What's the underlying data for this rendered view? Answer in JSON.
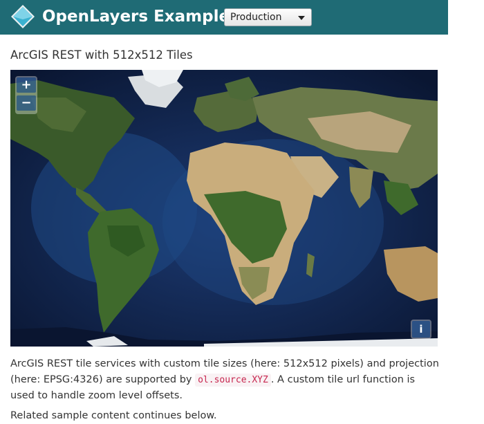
{
  "header": {
    "brand": "OpenLayers Examples",
    "mode_select": {
      "value": "Production"
    },
    "background_color": "#1f6b75"
  },
  "example": {
    "title": "ArcGIS REST with 512x512 Tiles"
  },
  "map": {
    "zoom_in_label": "+",
    "zoom_out_label": "−",
    "attribution_label": "i",
    "ocean_color": "#0b1a38"
  },
  "description": {
    "part1": "ArcGIS REST tile services with custom tile sizes (here: 512x512 pixels) and projection (here: EPSG:4326) are supported by ",
    "code": "ol.source.XYZ",
    "part2": ". A custom tile url function is used to handle zoom level offsets.",
    "next_line": "Related sample content continues below."
  }
}
